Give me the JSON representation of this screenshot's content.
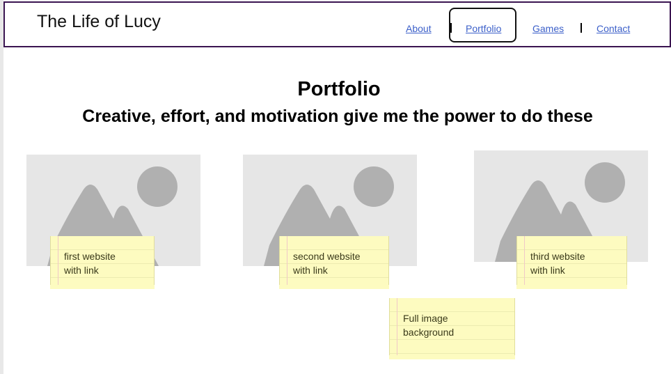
{
  "header": {
    "site_title": "The Life of Lucy",
    "nav": [
      {
        "label": "About",
        "active": false
      },
      {
        "label": "Portfolio",
        "active": true
      },
      {
        "label": "Games",
        "active": false
      },
      {
        "label": "Contact",
        "active": false
      }
    ]
  },
  "main": {
    "title": "Portfolio",
    "subtitle": "Creative, effort, and motivation give me the power to do these",
    "items": [
      {
        "thumbnail": "image-placeholder-icon",
        "note": "first website\nwith link"
      },
      {
        "thumbnail": "image-placeholder-icon",
        "note": "second website\nwith link"
      },
      {
        "thumbnail": "image-placeholder-icon",
        "note": "third website\nwith link"
      }
    ],
    "extra_note": "Full image\nbackground"
  },
  "colors": {
    "header_border": "#3a1450",
    "link": "#3b5fc9",
    "note_bg": "#fdfbc0",
    "placeholder_bg": "#e6e6e6",
    "placeholder_shape": "#b0b0b0"
  }
}
